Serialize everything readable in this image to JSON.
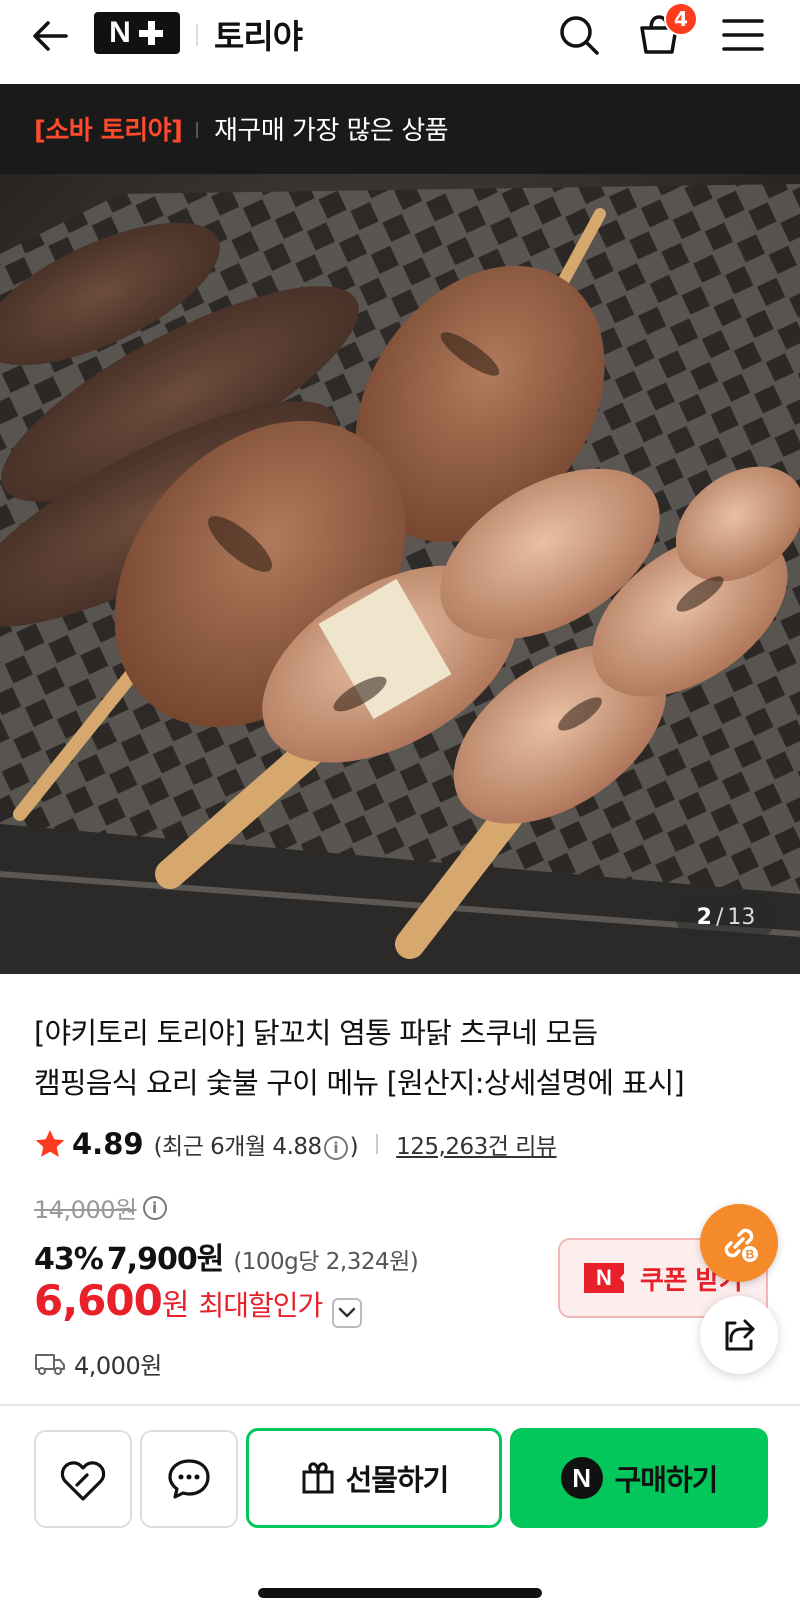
{
  "header": {
    "logo_letter": "N",
    "store_name": "토리야",
    "cart_count": "4",
    "icons": [
      "back-arrow-icon",
      "search-icon",
      "cart-icon",
      "hamburger-menu-icon"
    ]
  },
  "promo": {
    "tag": "[소바 토리야]",
    "text": "재구매 가장 많은 상품"
  },
  "gallery": {
    "current": "2",
    "separator": "/",
    "total": "13"
  },
  "product": {
    "title_line1": "[야키토리 토리야] 닭꼬치 염통 파닭 츠쿠네 모듬",
    "title_line2": "캠핑음식 요리 숯불 구이 메뉴 [원산지:상세설명에 표시]",
    "rating": "4.89",
    "recent_rating_prefix": "(최근 6개월 4.88",
    "recent_rating_suffix": ")",
    "review_count": "125,263건 리뷰",
    "original_price": "14,000원",
    "discount_rate": "43%",
    "sale_price": "7,900원",
    "unit_price": "(100g당 2,324원)",
    "max_discount_amount": "6,600",
    "max_discount_currency": "원",
    "max_discount_label": "최대할인가",
    "coupon_logo": "N",
    "coupon_label": "쿠폰 받기",
    "shipping_fee": "4,000원"
  },
  "actions": {
    "gift_label": "선물하기",
    "buy_logo": "N",
    "buy_label": "구매하기"
  },
  "colors": {
    "brand_green": "#03c75a",
    "sale_red": "#e8202a",
    "promo_orange": "#ff4b2b",
    "fab_orange": "#f58a2a"
  }
}
